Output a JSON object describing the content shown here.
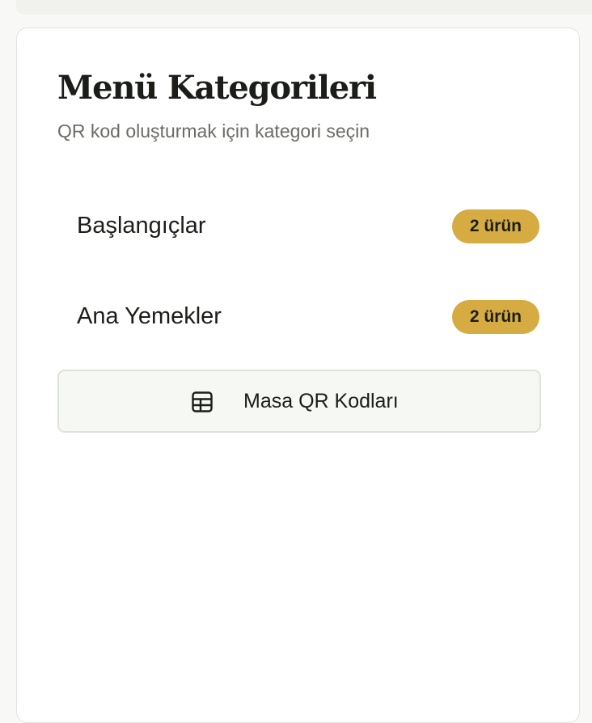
{
  "panel": {
    "title": "Menü Kategorileri",
    "subtitle": "QR kod oluşturmak için kategori seçin"
  },
  "categories": [
    {
      "label": "Başlangıçlar",
      "badge": "2 ürün"
    },
    {
      "label": "Ana Yemekler",
      "badge": "2 ürün"
    }
  ],
  "table_qr_button": {
    "label": "Masa QR Kodları",
    "icon": "table-grid-icon"
  },
  "colors": {
    "badge_background": "#d5ab42",
    "text_primary": "#1b1d19",
    "text_muted": "#6a6d66",
    "button_background": "#f6f8f3"
  }
}
